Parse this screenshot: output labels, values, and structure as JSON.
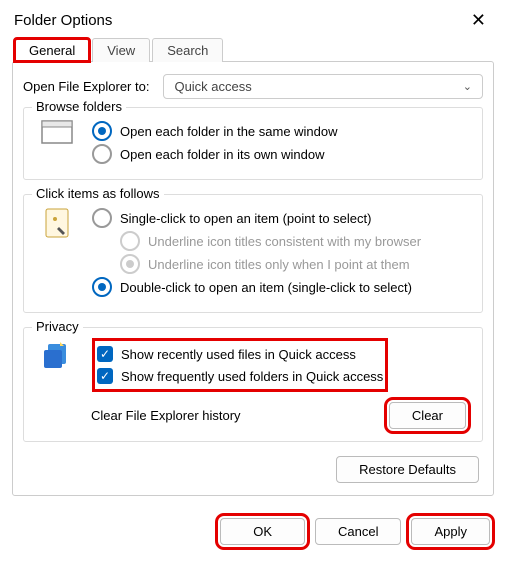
{
  "window": {
    "title": "Folder Options"
  },
  "tabs": {
    "general": "General",
    "view": "View",
    "search": "Search"
  },
  "open_explorer": {
    "label": "Open File Explorer to:",
    "value": "Quick access"
  },
  "browse": {
    "title": "Browse folders",
    "opt_same": "Open each folder in the same window",
    "opt_own": "Open each folder in its own window"
  },
  "click_items": {
    "title": "Click items as follows",
    "single": "Single-click to open an item (point to select)",
    "underline_browser": "Underline icon titles consistent with my browser",
    "underline_point": "Underline icon titles only when I point at them",
    "double": "Double-click to open an item (single-click to select)"
  },
  "privacy": {
    "title": "Privacy",
    "recent_files": "Show recently used files in Quick access",
    "frequent_folders": "Show frequently used folders in Quick access",
    "clear_label": "Clear File Explorer history",
    "clear_btn": "Clear"
  },
  "restore_btn": "Restore Defaults",
  "footer": {
    "ok": "OK",
    "cancel": "Cancel",
    "apply": "Apply"
  }
}
